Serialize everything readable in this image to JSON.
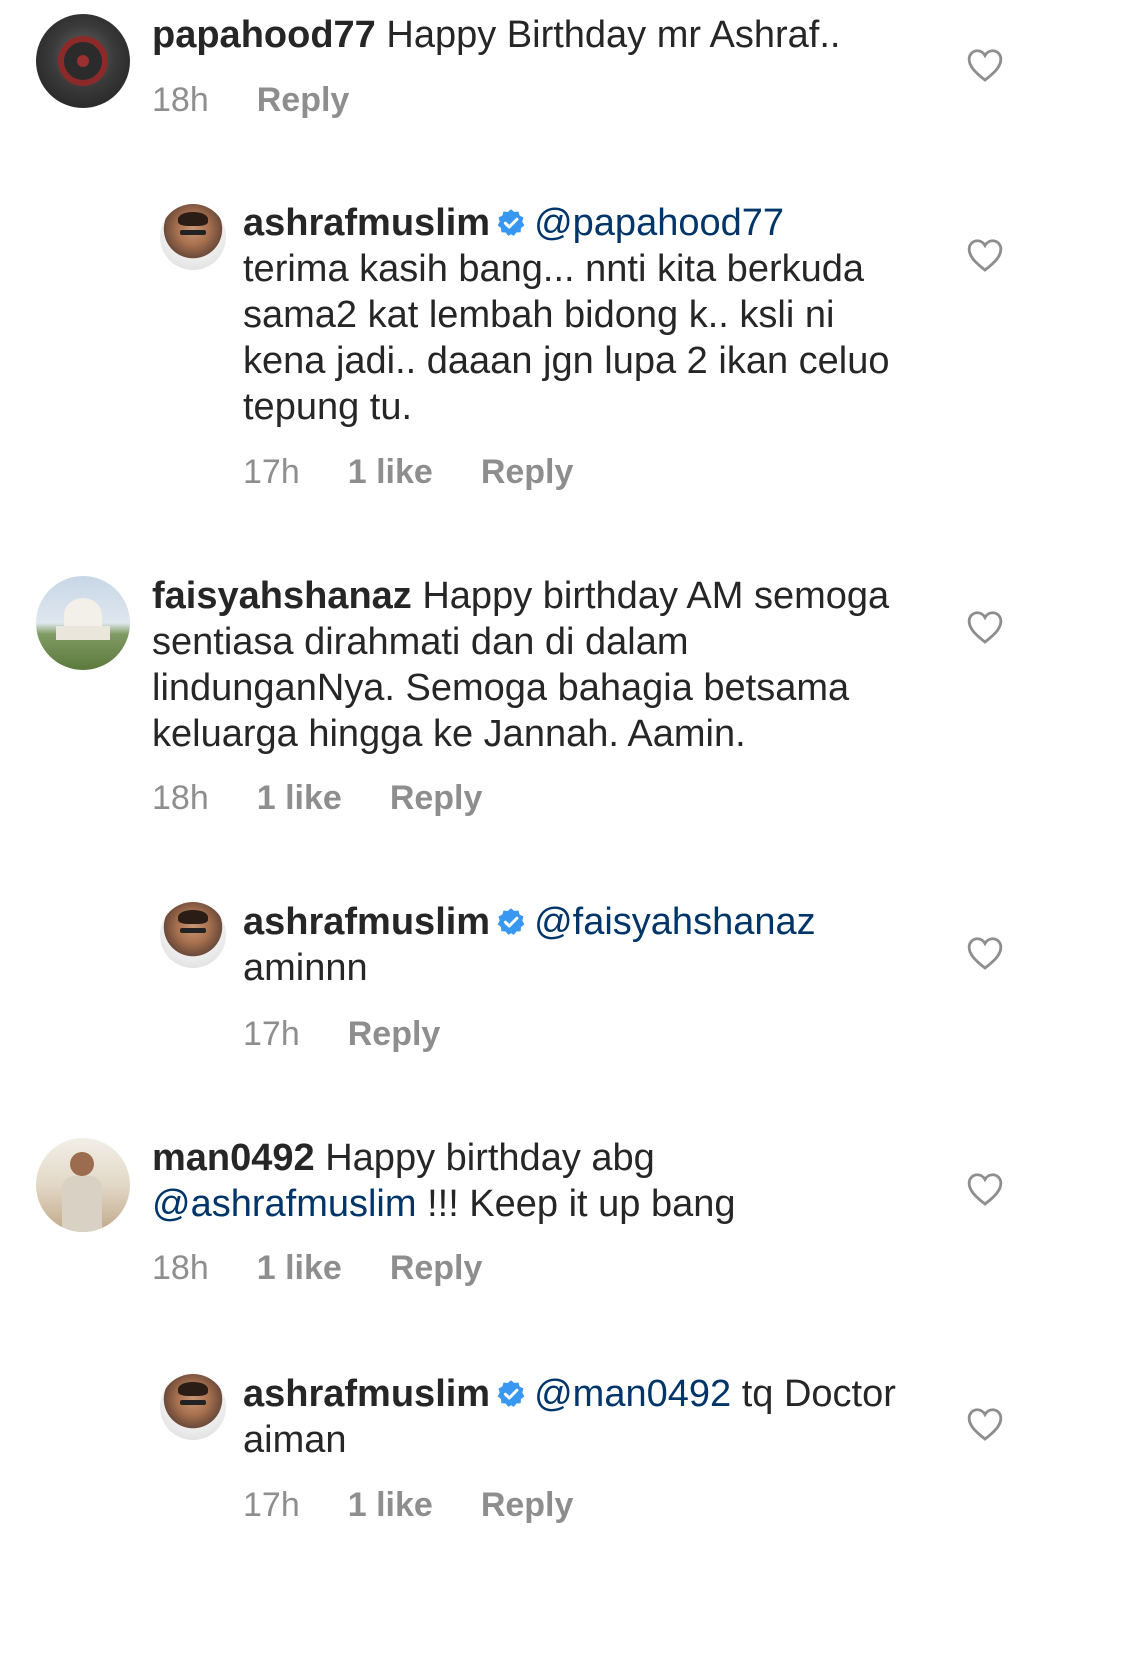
{
  "comments": [
    {
      "username": "papahood77",
      "text": "Happy Birthday mr Ashraf..",
      "time": "18h",
      "reply_label": "Reply",
      "avatar": "sith-emblem-avatar"
    },
    {
      "username": "ashrafmuslim",
      "verified": true,
      "mention": "@papahood77",
      "text": "terima kasih bang... nnti kita berkuda sama2 kat lembah bidong k.. ksli ni kena jadi.. daaan jgn lupa 2 ikan celuo tepung tu.",
      "time": "17h",
      "likes": "1 like",
      "reply_label": "Reply",
      "avatar": "man-portrait-avatar"
    },
    {
      "username": "faisyahshanaz",
      "text": "Happy birthday AM semoga sentiasa dirahmati dan di dalam lindunganNya. Semoga bahagia betsama keluarga hingga ke Jannah. Aamin.",
      "time": "18h",
      "likes": "1 like",
      "reply_label": "Reply",
      "avatar": "taj-mahal-avatar"
    },
    {
      "username": "ashrafmuslim",
      "verified": true,
      "mention": "@faisyahshanaz",
      "text": "aminnn",
      "time": "17h",
      "reply_label": "Reply",
      "avatar": "man-portrait-avatar"
    },
    {
      "username": "man0492",
      "text": "Happy birthday abg",
      "mention": "@ashrafmuslim",
      "text_after_mention": "!!! Keep it up bang",
      "time": "18h",
      "likes": "1 like",
      "reply_label": "Reply",
      "avatar": "man-standing-avatar"
    },
    {
      "username": "ashrafmuslim",
      "verified": true,
      "mention": "@man0492",
      "text": "tq Doctor aiman",
      "time": "17h",
      "likes": "1 like",
      "reply_label": "Reply",
      "avatar": "man-portrait-avatar"
    }
  ],
  "colors": {
    "text": "#262626",
    "meta": "#8e8e8e",
    "mention": "#003569",
    "verified": "#3897f0"
  }
}
